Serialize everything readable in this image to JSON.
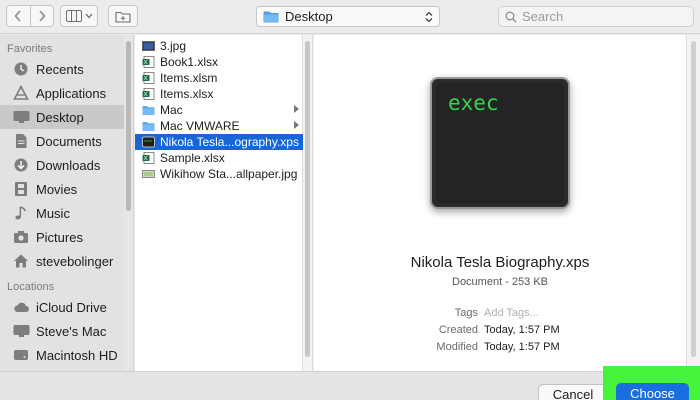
{
  "toolbar": {
    "location": "Desktop",
    "search_placeholder": "Search"
  },
  "sidebar": {
    "favorites_header": "Favorites",
    "favorites": [
      {
        "label": "Recents",
        "icon": "clock-icon"
      },
      {
        "label": "Applications",
        "icon": "applications-icon"
      },
      {
        "label": "Desktop",
        "icon": "desktop-icon",
        "selected": true
      },
      {
        "label": "Documents",
        "icon": "document-icon"
      },
      {
        "label": "Downloads",
        "icon": "download-icon"
      },
      {
        "label": "Movies",
        "icon": "film-icon"
      },
      {
        "label": "Music",
        "icon": "music-note-icon"
      },
      {
        "label": "Pictures",
        "icon": "camera-icon"
      },
      {
        "label": "stevebolinger",
        "icon": "home-icon"
      }
    ],
    "locations_header": "Locations",
    "locations": [
      {
        "label": "iCloud Drive",
        "icon": "cloud-icon"
      },
      {
        "label": "Steve's Mac",
        "icon": "computer-icon"
      },
      {
        "label": "Macintosh HD",
        "icon": "hard-drive-icon"
      }
    ]
  },
  "files": [
    {
      "name": "3.jpg",
      "icon": "image-file-icon"
    },
    {
      "name": "Book1.xlsx",
      "icon": "excel-file-icon"
    },
    {
      "name": "Items.xlsm",
      "icon": "excel-file-icon"
    },
    {
      "name": "Items.xlsx",
      "icon": "excel-file-icon"
    },
    {
      "name": "Mac",
      "icon": "folder-icon",
      "folder": true
    },
    {
      "name": "Mac VMWARE",
      "icon": "folder-icon",
      "folder": true
    },
    {
      "name": "Nikola Tesla...ography.xps",
      "icon": "exec-file-icon",
      "selected": true
    },
    {
      "name": "Sample.xlsx",
      "icon": "excel-file-icon"
    },
    {
      "name": "Wikihow Sta...allpaper.jpg",
      "icon": "image-file-icon"
    }
  ],
  "preview": {
    "icon_text": "exec",
    "name": "Nikola Tesla Biography.xps",
    "subtitle": "Document - 253 KB",
    "tags_label": "Tags",
    "tags_placeholder": "Add Tags...",
    "created_label": "Created",
    "created_value": "Today, 1:57 PM",
    "modified_label": "Modified",
    "modified_value": "Today, 1:57 PM"
  },
  "buttons": {
    "cancel": "Cancel",
    "choose": "Choose"
  },
  "colors": {
    "selection": "#1866d6",
    "choose_button": "#1a6fdf",
    "highlight": "#47f23a",
    "exec_text": "#38d24a"
  }
}
